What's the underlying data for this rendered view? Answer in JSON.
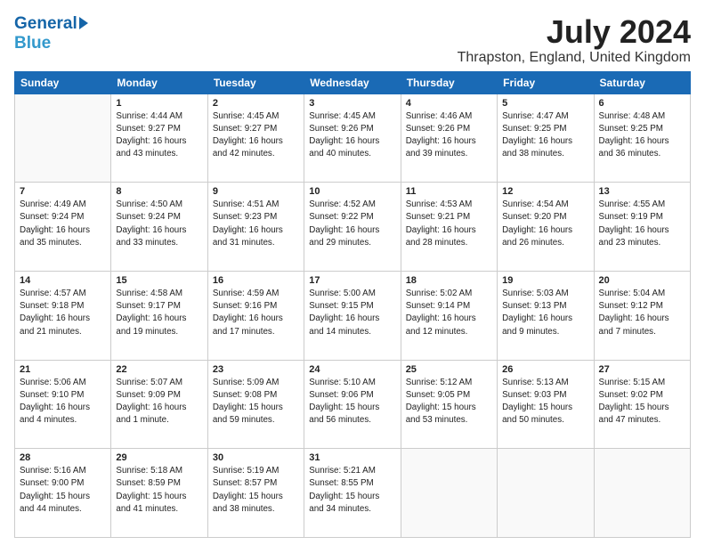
{
  "header": {
    "logo_line1": "General",
    "logo_line2": "Blue",
    "main_title": "July 2024",
    "subtitle": "Thrapston, England, United Kingdom"
  },
  "calendar": {
    "weekdays": [
      "Sunday",
      "Monday",
      "Tuesday",
      "Wednesday",
      "Thursday",
      "Friday",
      "Saturday"
    ],
    "weeks": [
      [
        {
          "day": "",
          "info": ""
        },
        {
          "day": "1",
          "info": "Sunrise: 4:44 AM\nSunset: 9:27 PM\nDaylight: 16 hours\nand 43 minutes."
        },
        {
          "day": "2",
          "info": "Sunrise: 4:45 AM\nSunset: 9:27 PM\nDaylight: 16 hours\nand 42 minutes."
        },
        {
          "day": "3",
          "info": "Sunrise: 4:45 AM\nSunset: 9:26 PM\nDaylight: 16 hours\nand 40 minutes."
        },
        {
          "day": "4",
          "info": "Sunrise: 4:46 AM\nSunset: 9:26 PM\nDaylight: 16 hours\nand 39 minutes."
        },
        {
          "day": "5",
          "info": "Sunrise: 4:47 AM\nSunset: 9:25 PM\nDaylight: 16 hours\nand 38 minutes."
        },
        {
          "day": "6",
          "info": "Sunrise: 4:48 AM\nSunset: 9:25 PM\nDaylight: 16 hours\nand 36 minutes."
        }
      ],
      [
        {
          "day": "7",
          "info": "Sunrise: 4:49 AM\nSunset: 9:24 PM\nDaylight: 16 hours\nand 35 minutes."
        },
        {
          "day": "8",
          "info": "Sunrise: 4:50 AM\nSunset: 9:24 PM\nDaylight: 16 hours\nand 33 minutes."
        },
        {
          "day": "9",
          "info": "Sunrise: 4:51 AM\nSunset: 9:23 PM\nDaylight: 16 hours\nand 31 minutes."
        },
        {
          "day": "10",
          "info": "Sunrise: 4:52 AM\nSunset: 9:22 PM\nDaylight: 16 hours\nand 29 minutes."
        },
        {
          "day": "11",
          "info": "Sunrise: 4:53 AM\nSunset: 9:21 PM\nDaylight: 16 hours\nand 28 minutes."
        },
        {
          "day": "12",
          "info": "Sunrise: 4:54 AM\nSunset: 9:20 PM\nDaylight: 16 hours\nand 26 minutes."
        },
        {
          "day": "13",
          "info": "Sunrise: 4:55 AM\nSunset: 9:19 PM\nDaylight: 16 hours\nand 23 minutes."
        }
      ],
      [
        {
          "day": "14",
          "info": "Sunrise: 4:57 AM\nSunset: 9:18 PM\nDaylight: 16 hours\nand 21 minutes."
        },
        {
          "day": "15",
          "info": "Sunrise: 4:58 AM\nSunset: 9:17 PM\nDaylight: 16 hours\nand 19 minutes."
        },
        {
          "day": "16",
          "info": "Sunrise: 4:59 AM\nSunset: 9:16 PM\nDaylight: 16 hours\nand 17 minutes."
        },
        {
          "day": "17",
          "info": "Sunrise: 5:00 AM\nSunset: 9:15 PM\nDaylight: 16 hours\nand 14 minutes."
        },
        {
          "day": "18",
          "info": "Sunrise: 5:02 AM\nSunset: 9:14 PM\nDaylight: 16 hours\nand 12 minutes."
        },
        {
          "day": "19",
          "info": "Sunrise: 5:03 AM\nSunset: 9:13 PM\nDaylight: 16 hours\nand 9 minutes."
        },
        {
          "day": "20",
          "info": "Sunrise: 5:04 AM\nSunset: 9:12 PM\nDaylight: 16 hours\nand 7 minutes."
        }
      ],
      [
        {
          "day": "21",
          "info": "Sunrise: 5:06 AM\nSunset: 9:10 PM\nDaylight: 16 hours\nand 4 minutes."
        },
        {
          "day": "22",
          "info": "Sunrise: 5:07 AM\nSunset: 9:09 PM\nDaylight: 16 hours\nand 1 minute."
        },
        {
          "day": "23",
          "info": "Sunrise: 5:09 AM\nSunset: 9:08 PM\nDaylight: 15 hours\nand 59 minutes."
        },
        {
          "day": "24",
          "info": "Sunrise: 5:10 AM\nSunset: 9:06 PM\nDaylight: 15 hours\nand 56 minutes."
        },
        {
          "day": "25",
          "info": "Sunrise: 5:12 AM\nSunset: 9:05 PM\nDaylight: 15 hours\nand 53 minutes."
        },
        {
          "day": "26",
          "info": "Sunrise: 5:13 AM\nSunset: 9:03 PM\nDaylight: 15 hours\nand 50 minutes."
        },
        {
          "day": "27",
          "info": "Sunrise: 5:15 AM\nSunset: 9:02 PM\nDaylight: 15 hours\nand 47 minutes."
        }
      ],
      [
        {
          "day": "28",
          "info": "Sunrise: 5:16 AM\nSunset: 9:00 PM\nDaylight: 15 hours\nand 44 minutes."
        },
        {
          "day": "29",
          "info": "Sunrise: 5:18 AM\nSunset: 8:59 PM\nDaylight: 15 hours\nand 41 minutes."
        },
        {
          "day": "30",
          "info": "Sunrise: 5:19 AM\nSunset: 8:57 PM\nDaylight: 15 hours\nand 38 minutes."
        },
        {
          "day": "31",
          "info": "Sunrise: 5:21 AM\nSunset: 8:55 PM\nDaylight: 15 hours\nand 34 minutes."
        },
        {
          "day": "",
          "info": ""
        },
        {
          "day": "",
          "info": ""
        },
        {
          "day": "",
          "info": ""
        }
      ]
    ]
  }
}
